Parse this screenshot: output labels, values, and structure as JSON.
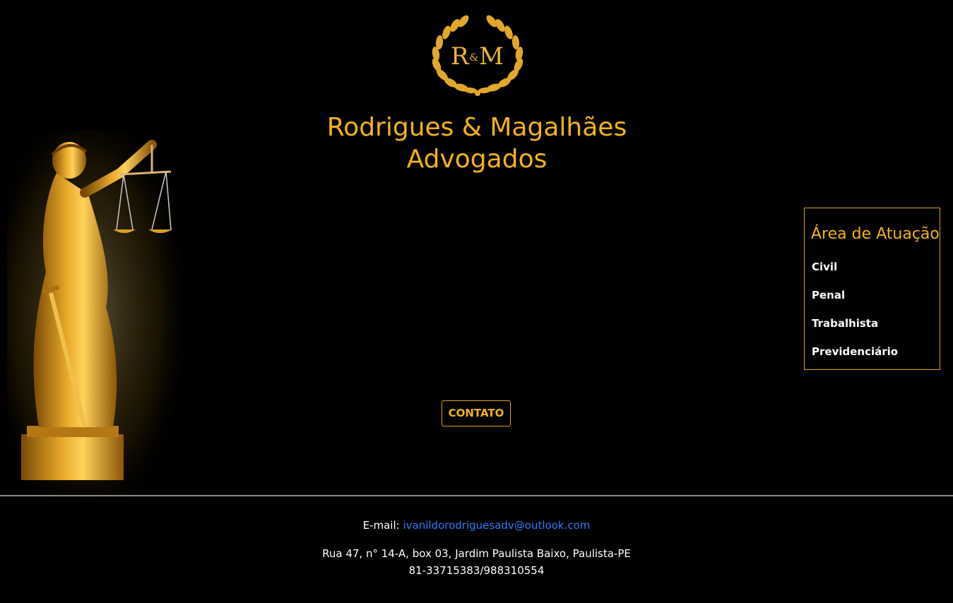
{
  "logo": {
    "letter_left": "R",
    "ampersand": "&",
    "letter_right": "M",
    "color": "#e9b53a"
  },
  "header": {
    "title_line1": "Rodrigues & Magalhães",
    "title_line2": "Advogados",
    "color": "#f3b21d"
  },
  "area": {
    "title": "Área de Atuação",
    "items": [
      "Civil",
      "Penal",
      "Trabalhista",
      "Previdenciário"
    ]
  },
  "contact_button": {
    "label": "CONTATO"
  },
  "footer": {
    "email_label": "E-mail:",
    "email": "ivanildorodriguesadv@outlook.com",
    "address": "Rua 47, n° 14-A, box 03, Jardim Paulista Baixo, Paulista-PE",
    "phone": "81-33715383/988310554",
    "link_color": "#2f7cf6"
  }
}
